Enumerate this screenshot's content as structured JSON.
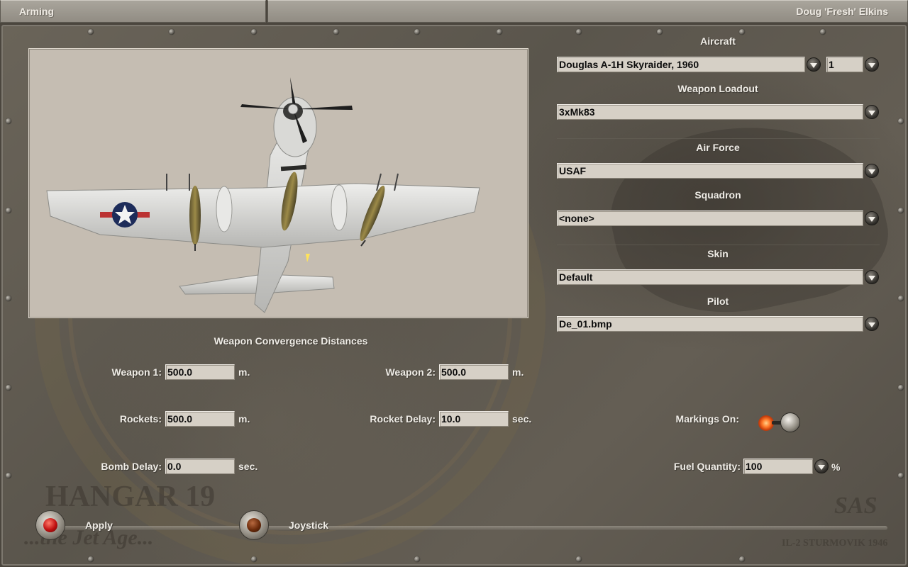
{
  "titlebar": {
    "screen": "Arming",
    "user": "Doug 'Fresh' Elkins"
  },
  "aircraft": {
    "section_label": "Aircraft",
    "selected": "Douglas A-1H Skyraider, 1960",
    "number": "1"
  },
  "loadout": {
    "section_label": "Weapon Loadout",
    "selected": "3xMk83"
  },
  "air_force": {
    "section_label": "Air Force",
    "selected": "USAF"
  },
  "squadron": {
    "section_label": "Squadron",
    "selected": "<none>"
  },
  "skin": {
    "section_label": "Skin",
    "selected": "Default"
  },
  "pilot": {
    "section_label": "Pilot",
    "selected": "De_01.bmp"
  },
  "convergence": {
    "heading": "Weapon Convergence Distances",
    "weapon1": {
      "label": "Weapon 1:",
      "value": "500.0",
      "unit": "m."
    },
    "weapon2": {
      "label": "Weapon 2:",
      "value": "500.0",
      "unit": "m."
    },
    "rockets": {
      "label": "Rockets:",
      "value": "500.0",
      "unit": "m."
    },
    "rocket_delay": {
      "label": "Rocket Delay:",
      "value": "10.0",
      "unit": "sec."
    },
    "bomb_delay": {
      "label": "Bomb Delay:",
      "value": "0.0",
      "unit": "sec."
    }
  },
  "markings": {
    "label": "Markings On:",
    "on": true
  },
  "fuel": {
    "label": "Fuel Quantity:",
    "value": "100",
    "unit": "%"
  },
  "buttons": {
    "apply": "Apply",
    "joystick": "Joystick"
  },
  "watermarks": {
    "hangar": "HANGAR 19",
    "tagline": "...the Jet Age...",
    "sas": "SAS",
    "il2": "IL-2 STURMOVIK 1946"
  },
  "icons": {
    "dropdown": "chevron-down-icon",
    "apply_lamp": "red-lamp-icon",
    "joystick_lamp": "brown-lamp-icon",
    "markings_toggle": "toggle-switch-icon"
  },
  "colors": {
    "field_bg": "#d6d0c6",
    "viewer_bg": "#c5bdb2",
    "title_bar": "#a09b92"
  }
}
